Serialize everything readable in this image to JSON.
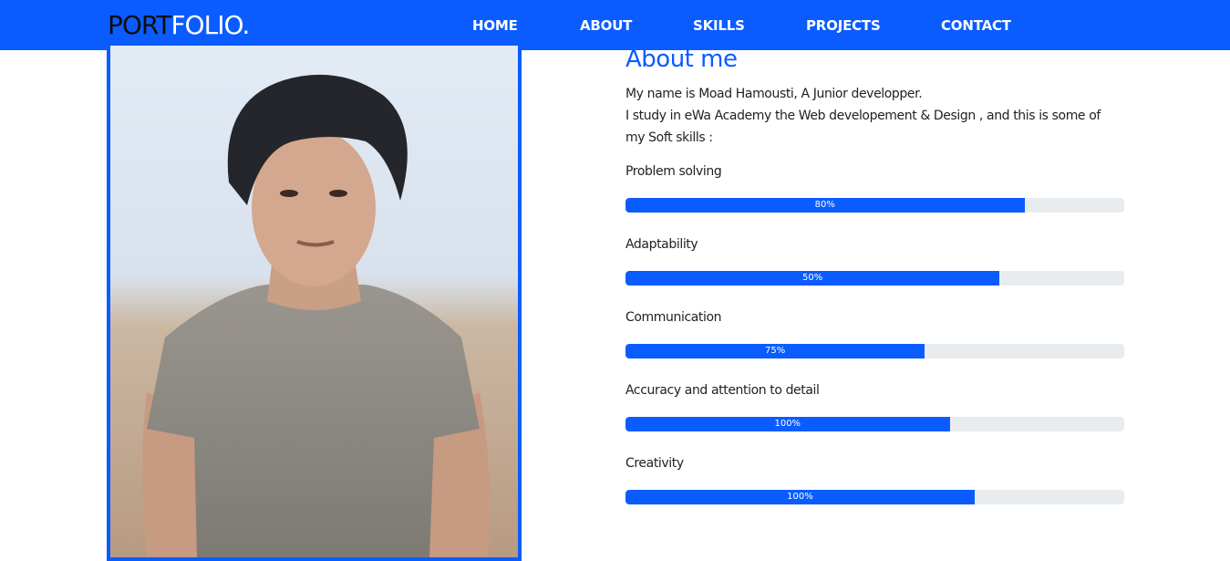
{
  "brand": {
    "part1": "PORT",
    "part2": "FOLIO."
  },
  "nav": {
    "items": [
      {
        "label": "HOME"
      },
      {
        "label": "ABOUT"
      },
      {
        "label": "SKILLS"
      },
      {
        "label": "PROJECTS"
      },
      {
        "label": "CONTACT"
      }
    ]
  },
  "photo": {
    "alt": "Portrait photo"
  },
  "about": {
    "title": "About me",
    "line1": "My name is Moad Hamousti, A Junior developper.",
    "line2": "I study in eWa Academy the Web developement & Design , and this is some of my Soft skills :"
  },
  "skills": [
    {
      "label": "Problem solving",
      "text": "80%",
      "fill": 0.8
    },
    {
      "label": "Adaptability",
      "text": "50%",
      "fill": 0.75
    },
    {
      "label": "Communication",
      "text": "75%",
      "fill": 0.6
    },
    {
      "label": "Accuracy and attention to detail",
      "text": "100%",
      "fill": 0.65
    },
    {
      "label": "Creativity",
      "text": "100%",
      "fill": 0.7
    }
  ],
  "colors": {
    "accent": "#0a5cff",
    "track": "#e9ecef"
  }
}
